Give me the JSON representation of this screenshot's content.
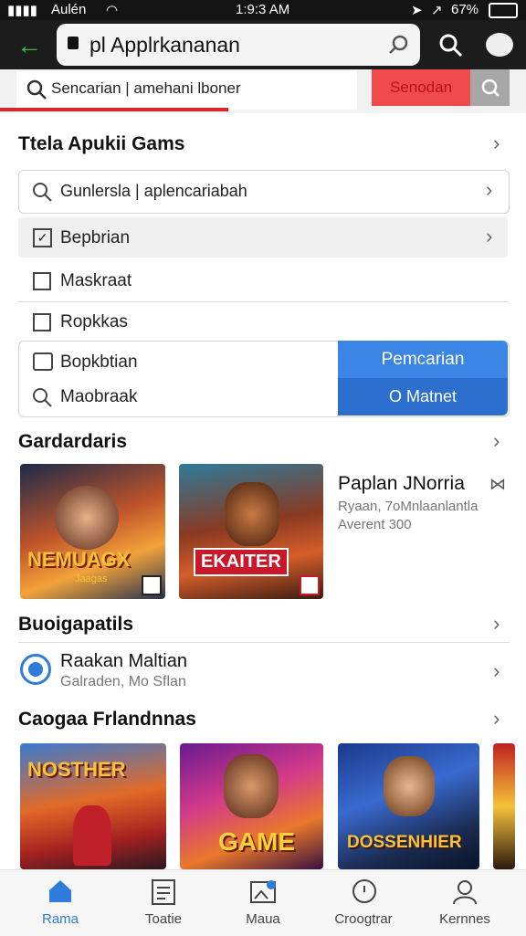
{
  "status": {
    "carrier": "Aulén",
    "time": "1:9:3 AM",
    "battery": "67%"
  },
  "browser": {
    "url_text": "pl Applrkananan"
  },
  "search": {
    "placeholder": "Sencarian | amehani lboner",
    "red_button": "Senodan"
  },
  "section1": {
    "title": "Ttela Apukii Gams",
    "input_text": "Gunlersla | aplencariabah",
    "items": [
      "Bepbrian",
      "Maskraat",
      "Ropkkas"
    ],
    "box_items": [
      "Bopkbtian",
      "Maobraak"
    ],
    "btn_primary": "Pemcarian",
    "btn_secondary": "O Matnet"
  },
  "section2": {
    "title": "Gardardaris",
    "cards": [
      "NEMUAGX",
      "EKAITER"
    ],
    "card_sub": [
      "Jaagas",
      ""
    ],
    "info_title": "Paplan JNorria",
    "info_line1": "Ryaan, 7oMnlaanlantla",
    "info_line2": "Averent 300"
  },
  "section3": {
    "title": "Buoigapatils",
    "app_title": "Raakan Maltian",
    "app_sub": "Galraden, Mo Sflan"
  },
  "section4": {
    "title": "Caogaa Frlandnnas",
    "cards": [
      "NOSTHER",
      "GAME",
      "DOSSENHIER"
    ]
  },
  "nav": {
    "items": [
      {
        "label": "Rama",
        "icon": "home-icon"
      },
      {
        "label": "Toatie",
        "icon": "document-icon"
      },
      {
        "label": "Maua",
        "icon": "image-icon"
      },
      {
        "label": "Croogtrar",
        "icon": "chat-icon"
      },
      {
        "label": "Kernnes",
        "icon": "profile-icon"
      }
    ]
  },
  "colors": {
    "accent_blue": "#2f7bdc",
    "accent_red": "#ef4b4b",
    "dark_bar": "#1c1c1c"
  }
}
